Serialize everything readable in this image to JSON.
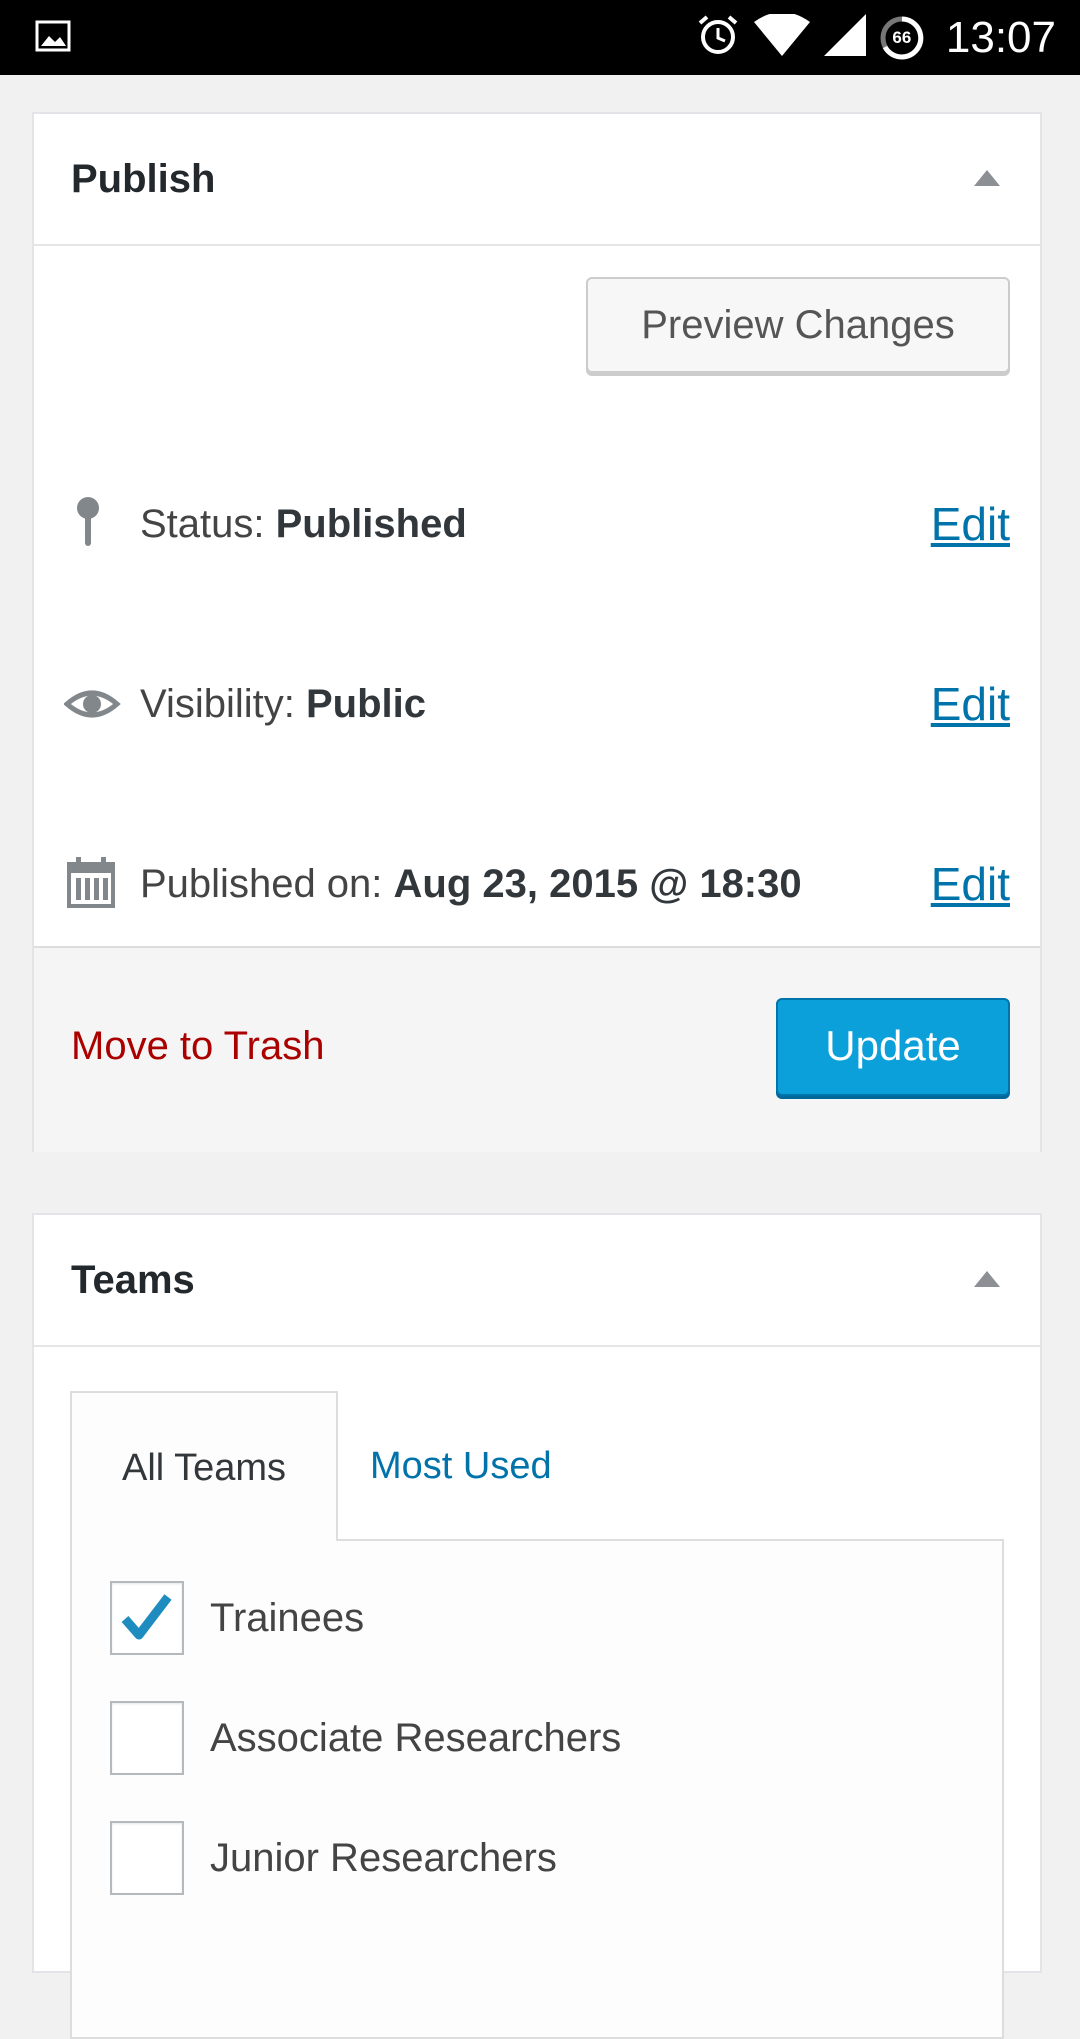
{
  "status_bar": {
    "time": "13:07",
    "battery_level": "66",
    "icons": [
      "image-icon",
      "alarm-icon",
      "wifi-icon",
      "signal-icon",
      "battery-icon"
    ]
  },
  "publish": {
    "title": "Publish",
    "preview_label": "Preview Changes",
    "status_label": "Status: ",
    "status_value": "Published",
    "visibility_label": "Visibility: ",
    "visibility_value": "Public",
    "published_label": "Published on: ",
    "published_value": "Aug 23, 2015 @ 18:30",
    "edit_label": "Edit",
    "trash_label": "Move to Trash",
    "update_label": "Update"
  },
  "teams": {
    "title": "Teams",
    "tab_all": "All Teams",
    "tab_most_used": "Most Used",
    "items": [
      {
        "label": "Trainees",
        "checked": true
      },
      {
        "label": "Associate Researchers",
        "checked": false
      },
      {
        "label": "Junior Researchers",
        "checked": false
      }
    ]
  },
  "colors": {
    "link": "#0073aa",
    "primary_button": "#0ba0d9",
    "trash": "#aa0000",
    "checkmark": "#1e8cbe"
  }
}
